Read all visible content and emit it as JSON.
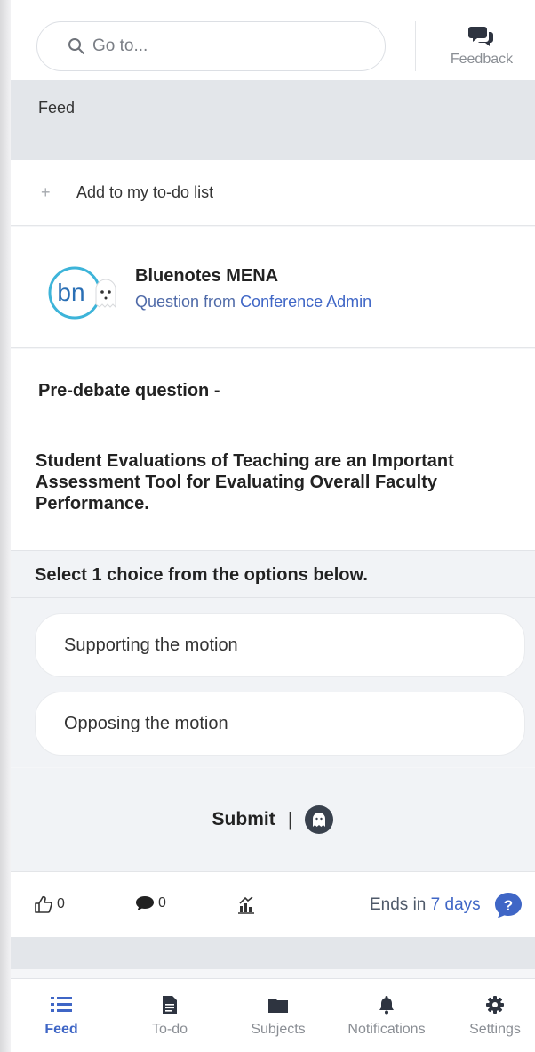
{
  "search": {
    "placeholder": "Go to..."
  },
  "header": {
    "feedback_label": "Feedback"
  },
  "feed": {
    "title": "Feed"
  },
  "todo": {
    "add_label": "Add to my to-do list"
  },
  "post": {
    "author": "Bluenotes MENA",
    "subtitle_prefix": "Question from",
    "subtitle_name": "Conference Admin",
    "avatar_text": "bn",
    "question_heading": "Pre-debate question -",
    "question_text": "Student Evaluations of Teaching are an Important Assessment Tool for Evaluating Overall Faculty Performance.",
    "options_title": "Select 1 choice from the options below.",
    "options": [
      "Supporting the motion",
      "Opposing the motion"
    ],
    "submit_label": "Submit",
    "submit_separator": "|",
    "likes": "0",
    "comments": "0",
    "ends_prefix": "Ends in",
    "ends_days": "7 days"
  },
  "nav": {
    "items": [
      {
        "label": "Feed",
        "icon": "list-icon"
      },
      {
        "label": "To-do",
        "icon": "document-icon"
      },
      {
        "label": "Subjects",
        "icon": "folder-icon"
      },
      {
        "label": "Notifications",
        "icon": "bell-icon"
      },
      {
        "label": "Settings",
        "icon": "gear-icon"
      }
    ]
  },
  "colors": {
    "accent": "#3f66c6",
    "background": "#f5f6f8",
    "card": "#ffffff",
    "text": "#222222"
  }
}
